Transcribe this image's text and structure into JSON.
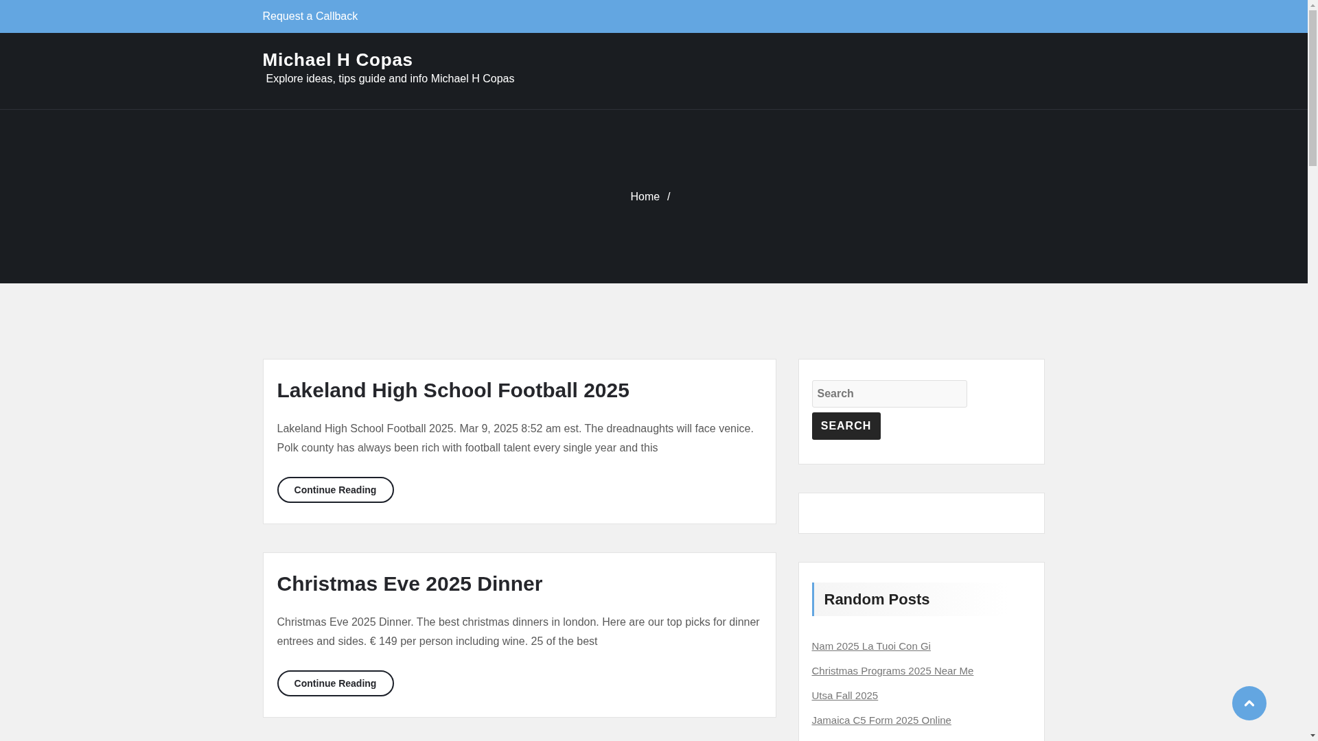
{
  "top_bar": {
    "link": "Request a Callback"
  },
  "header": {
    "site_title": "Michael H Copas",
    "tagline": "Explore ideas, tips guide and info Michael H Copas"
  },
  "breadcrumb": {
    "items": [
      "Home"
    ],
    "separator": "/"
  },
  "posts": [
    {
      "title": "Lakeland High School Football 2025",
      "excerpt": "Lakeland High School Football 2025. Mar 9, 2025 8:52 am est. The dreadnaughts will face venice. Polk county has always been rich with football talent every single year and this",
      "button": "Continue Reading"
    },
    {
      "title": "Christmas Eve 2025 Dinner",
      "excerpt": "Christmas Eve 2025 Dinner. The best christmas dinners in london. Here are our top picks for dinner entrees and sides. € 149 per person including wine. 25 of the best",
      "button": "Continue Reading"
    }
  ],
  "sidebar": {
    "search": {
      "placeholder": "Search",
      "button": "SEARCH"
    },
    "random_posts": {
      "title": "Random Posts",
      "links": [
        "Nam 2025 La Tuoi Con Gi",
        "Christmas Programs 2025 Near Me",
        "Utsa Fall 2025",
        "Jamaica C5 Form 2025 Online"
      ]
    }
  }
}
